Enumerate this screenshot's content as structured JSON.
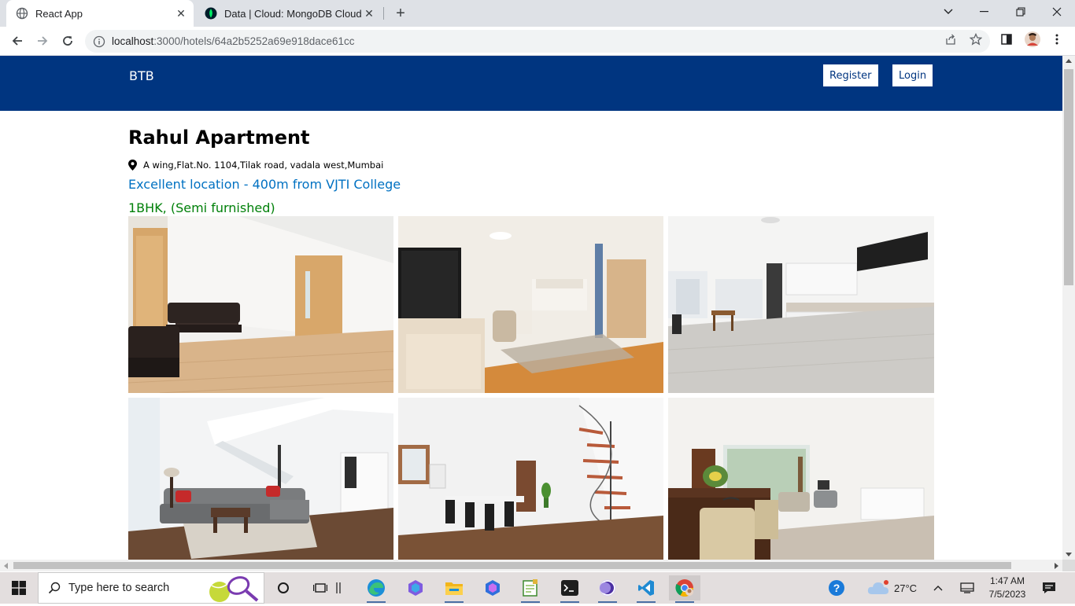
{
  "browser": {
    "tabs": [
      {
        "title": "React App",
        "active": true
      },
      {
        "title": "Data | Cloud: MongoDB Cloud",
        "active": false
      }
    ],
    "url_host": "localhost",
    "url_path": ":3000/hotels/64a2b5252a69e918dace61cc"
  },
  "site": {
    "brand": "BTB",
    "register_label": "Register",
    "login_label": "Login",
    "brand_color": "#003580"
  },
  "hotel": {
    "name": "Rahul Apartment",
    "address": "A wing,Flat.No. 1104,Tilak road, vadala west,Mumbai",
    "distance": "Excellent location - 400m from VJTI College",
    "room_type": "1BHK, (Semi furnished)",
    "photos": [
      {
        "alt": "living-room-with-sofa"
      },
      {
        "alt": "living-room-with-tv"
      },
      {
        "alt": "open-kitchen"
      },
      {
        "alt": "living-room-with-staircase"
      },
      {
        "alt": "dining-area-with-spiral-staircase"
      },
      {
        "alt": "dining-and-living-area"
      }
    ]
  },
  "taskbar": {
    "search_placeholder": "Type here to search",
    "weather": "27°C",
    "time": "1:47 AM",
    "date": "7/5/2023"
  }
}
